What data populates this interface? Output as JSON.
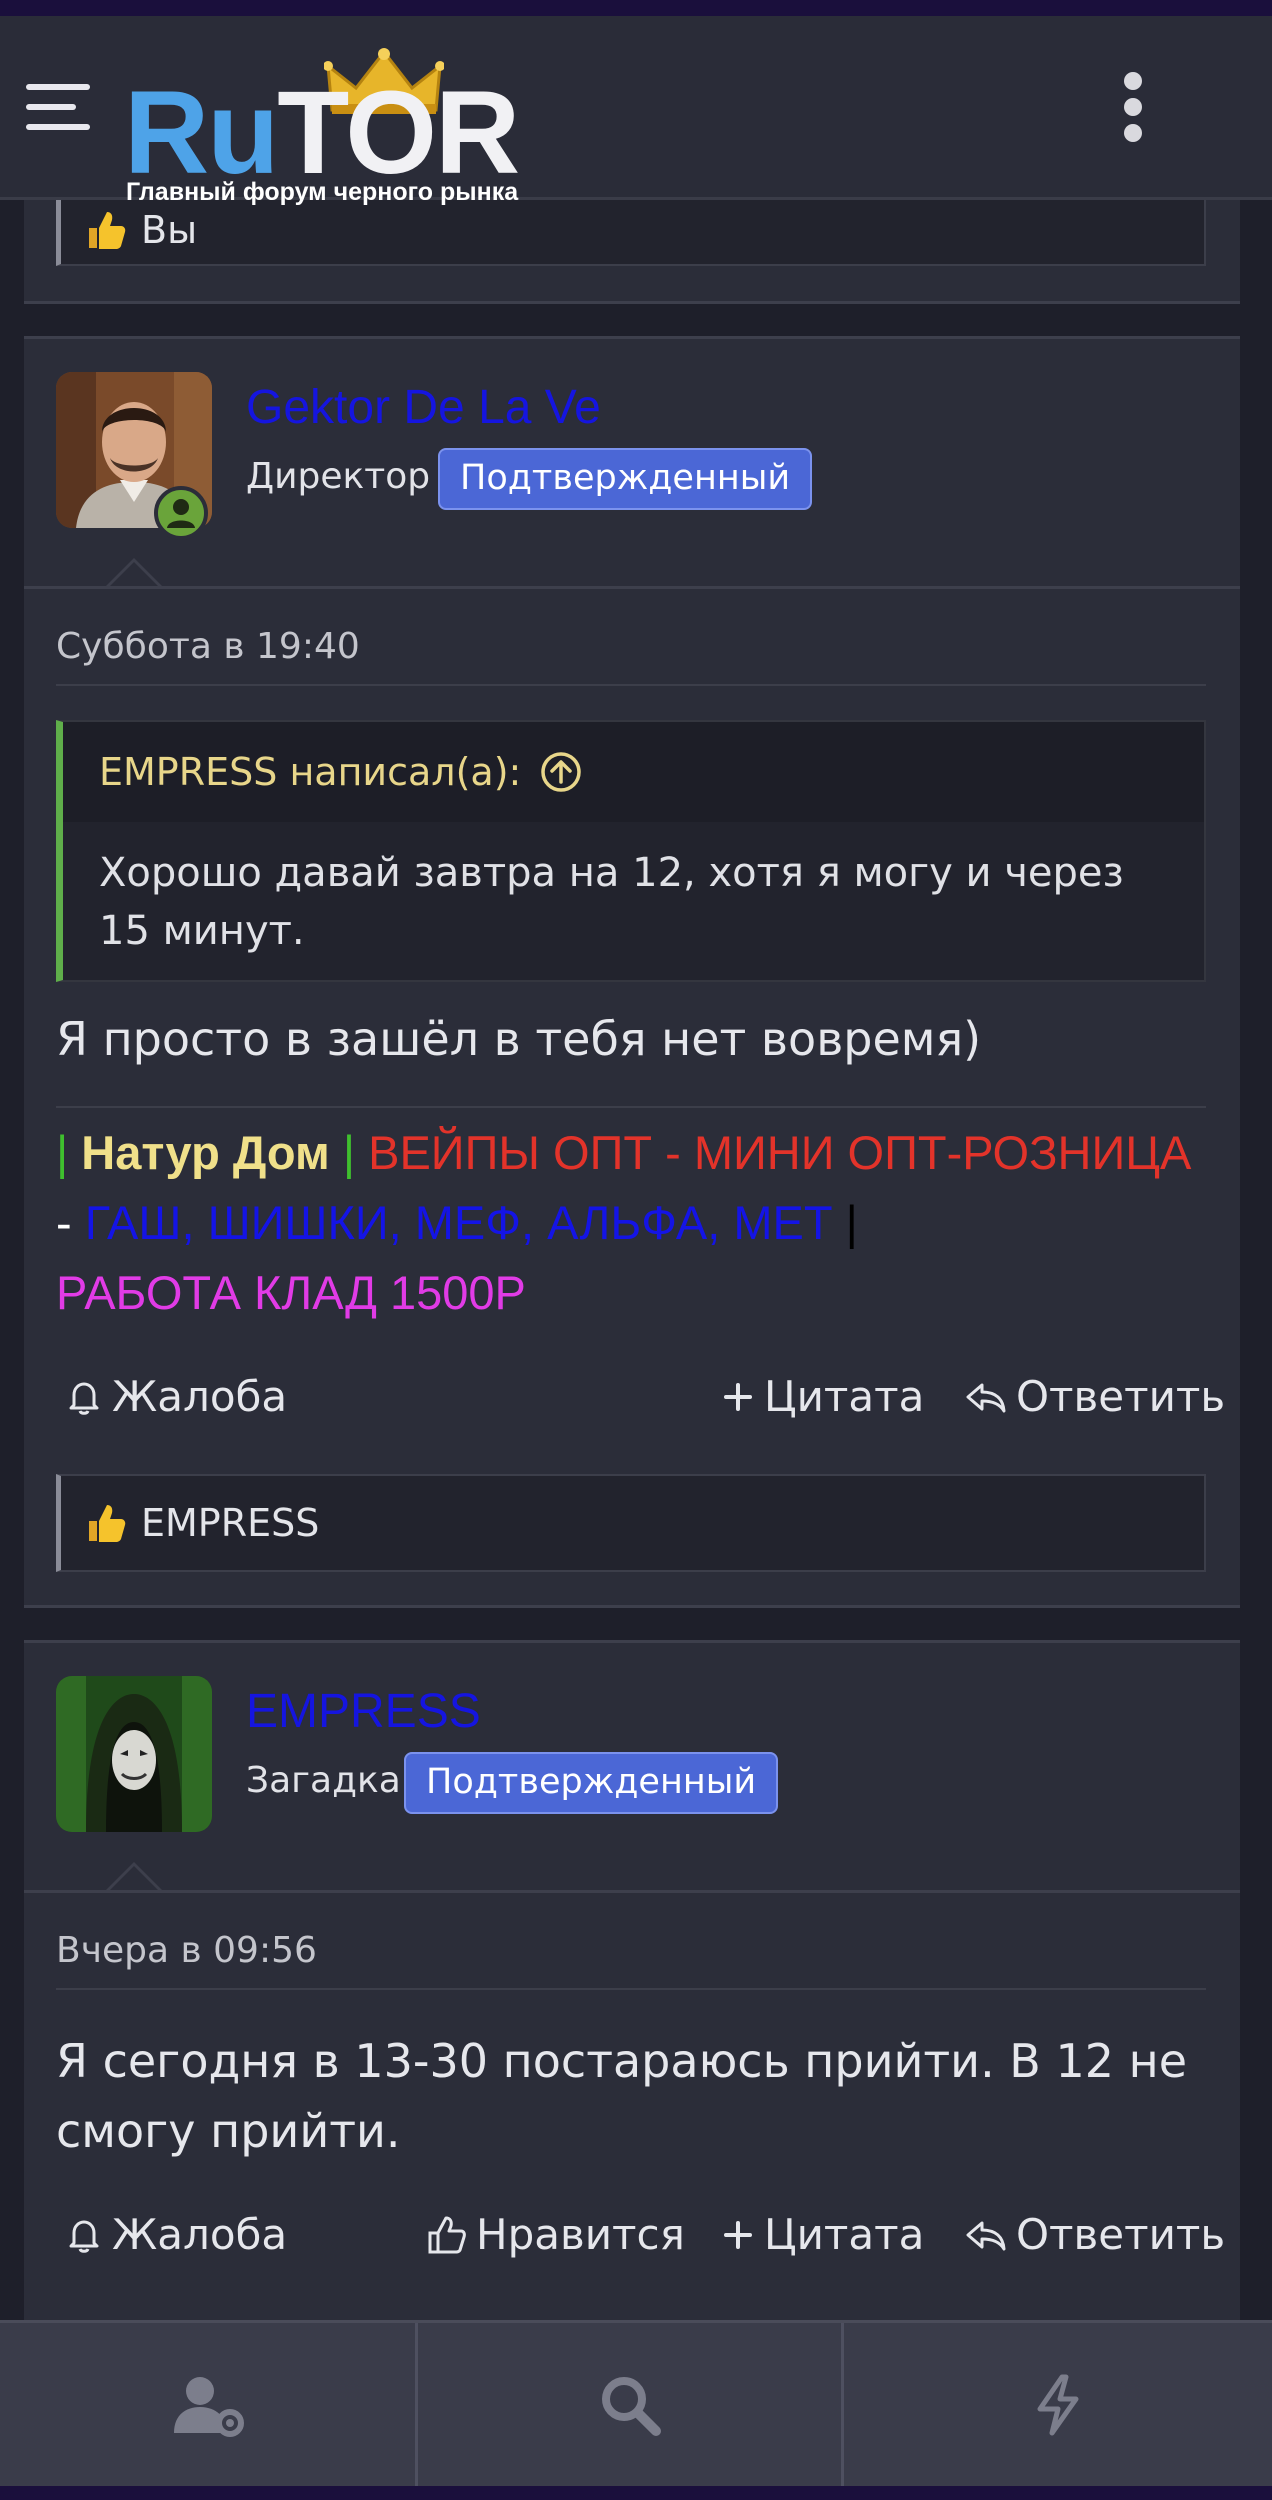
{
  "header": {
    "logo_ru": "Ru",
    "logo_tor": "TOR",
    "tagline": "Главный форум черного рынка"
  },
  "prev_post": {
    "reaction_text": "Вы"
  },
  "post1": {
    "username": "Gektor De La Ve",
    "role": "Директор",
    "badge": "Подтвержденный",
    "timestamp": "Суббота в 19:40",
    "quote_author": "EMPRESS написал(а):",
    "quote_text": "Хорошо давай завтра на 12, хотя я могу и через 15 минут.",
    "text": "Я просто в зашёл в тебя нет вовремя)",
    "signature": {
      "bar1": "|",
      "shop": " Натур Дом ",
      "bar2": "|",
      "vapes": " ВЕЙПЫ ОПТ - МИНИ ОПТ-РОЗНИЦА",
      "dash": " - ",
      "goods": "ГАШ, ШИШКИ, МЕФ, АЛЬФА, МЕТ",
      "bar3": " |",
      "job": "РАБОТА КЛАД 1500Р"
    },
    "actions": {
      "report": "Жалоба",
      "quote": "Цитата",
      "reply": "Ответить"
    },
    "reaction_text": "EMPRESS"
  },
  "post2": {
    "username": "EMPRESS",
    "role": "Загадка",
    "badge": "Подтвержденный",
    "timestamp": "Вчера в 09:56",
    "text": "Я сегодня в 13-30 постараюсь прийти. В 12 не смогу прийти.",
    "actions": {
      "report": "Жалоба",
      "like": "Нравится",
      "quote": "Цитата",
      "reply": "Ответить"
    }
  },
  "colors": {
    "brand_blue": "#4ea3e8",
    "username": "#1515e0",
    "badge": "#4b67d6",
    "quote_border": "#5fae4a",
    "online": "#6aa43a"
  },
  "icons": {
    "menu": "hamburger-menu-icon",
    "more": "vertical-dots-icon",
    "account": "user-settings-icon",
    "search": "search-icon",
    "activity": "lightning-icon"
  }
}
